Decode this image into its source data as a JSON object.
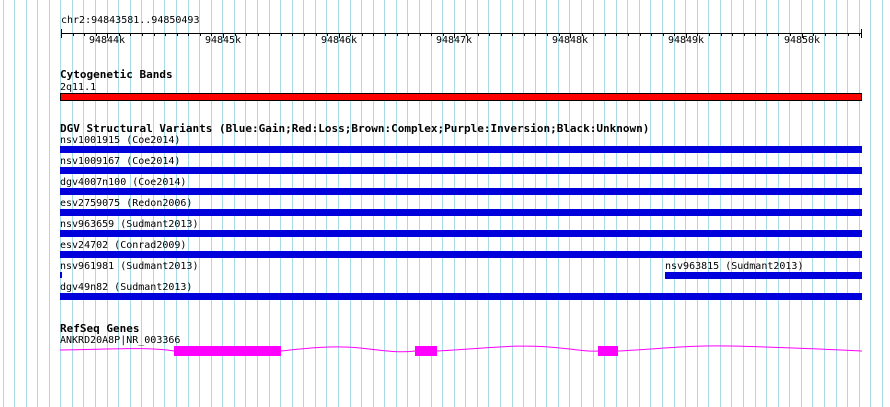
{
  "ruler": {
    "title": "chr2:94843581..94850493",
    "ticks": [
      "94844k",
      "94845k",
      "94846k",
      "94847k",
      "94848k",
      "94849k",
      "94850k"
    ]
  },
  "cytoband": {
    "title": "Cytogenetic Bands",
    "band_label": "2q11.1",
    "band_color": "#ff0000"
  },
  "dgv": {
    "title": "DGV Structural Variants (Blue:Gain;Red:Loss;Brown:Complex;Purple:Inversion;Black:Unknown)",
    "gain_color": "#0000dd",
    "variants": [
      {
        "label": "nsv1001915 (Coe2014)"
      },
      {
        "label": "nsv1009167 (Coe2014)"
      },
      {
        "label": "dgv4007n100 (Coe2014)"
      },
      {
        "label": "esv2759075 (Redon2006)"
      },
      {
        "label": "nsv963659 (Sudmant2013)"
      },
      {
        "label": "esv24702 (Conrad2009)"
      },
      {
        "label": "nsv961981 (Sudmant2013)"
      },
      {
        "label": "nsv963815 (Sudmant2013)"
      },
      {
        "label": "dgv49n82 (Sudmant2013)"
      }
    ]
  },
  "refseq": {
    "title": "RefSeq Genes",
    "gene_label": "ANKRD20A8P|NR_003366",
    "gene_color": "#ff00ff"
  },
  "grid_color": "#a8dbe6"
}
